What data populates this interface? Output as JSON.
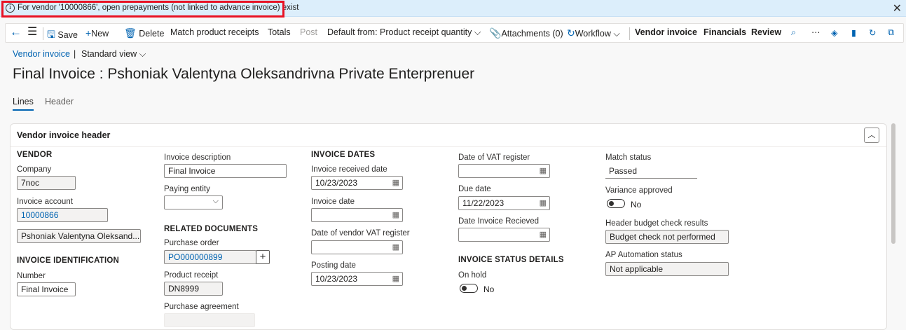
{
  "notification": {
    "icon": "info-icon",
    "text": "For vendor '10000866', open prepayments (not linked to advance invoice) exist"
  },
  "actions": {
    "save": "Save",
    "new": "New",
    "delete": "Delete",
    "match_receipts": "Match product receipts",
    "totals": "Totals",
    "post": "Post",
    "default_from": "Default from: Product receipt quantity",
    "attachments": "Attachments (0)",
    "workflow": "Workflow",
    "vendor_invoice": "Vendor invoice",
    "financials": "Financials",
    "review": "Review"
  },
  "breadcrumb": {
    "link": "Vendor invoice",
    "sep": "|",
    "view": "Standard view"
  },
  "page_title": "Final Invoice : Pshoniak Valentyna Oleksandrivna Private Enterprenuer",
  "tabs": {
    "lines": "Lines",
    "header": "Header"
  },
  "card": {
    "title": "Vendor invoice header",
    "vendor": {
      "title": "VENDOR",
      "company_label": "Company",
      "company": "7noc",
      "account_label": "Invoice account",
      "account": "10000866",
      "vendor_name": "Pshoniak Valentyna Oleksand..."
    },
    "identification": {
      "title": "INVOICE IDENTIFICATION",
      "number_label": "Number",
      "number": "Final Invoice"
    },
    "description": {
      "label": "Invoice description",
      "value": "Final Invoice"
    },
    "paying_entity": {
      "label": "Paying entity",
      "value": ""
    },
    "related": {
      "title": "RELATED DOCUMENTS",
      "po_label": "Purchase order",
      "po": "PO000000899",
      "receipt_label": "Product receipt",
      "receipt": "DN8999",
      "agreement_label": "Purchase agreement",
      "agreement": ""
    },
    "dates": {
      "title": "INVOICE DATES",
      "received_label": "Invoice received date",
      "received": "10/23/2023",
      "invoice_date_label": "Invoice date",
      "invoice_date": "",
      "vendor_vat_label": "Date of vendor VAT register",
      "vendor_vat": "",
      "posting_label": "Posting date",
      "posting": "10/23/2023"
    },
    "col4": {
      "vat_label": "Date of VAT register",
      "vat": "",
      "due_label": "Due date",
      "due": "11/22/2023",
      "recieved_label": "Date Invoice Recieved",
      "recieved": "",
      "status_title": "INVOICE STATUS DETAILS",
      "on_hold_label": "On hold",
      "on_hold": "No"
    },
    "col5": {
      "match_label": "Match status",
      "match": "Passed",
      "variance_label": "Variance approved",
      "variance": "No",
      "budget_label": "Header budget check results",
      "budget": "Budget check not performed",
      "ap_label": "AP Automation status",
      "ap": "Not applicable"
    }
  },
  "colors": {
    "accent": "#0063b1",
    "notification_bg": "#dceefb",
    "highlight": "#e81123"
  }
}
